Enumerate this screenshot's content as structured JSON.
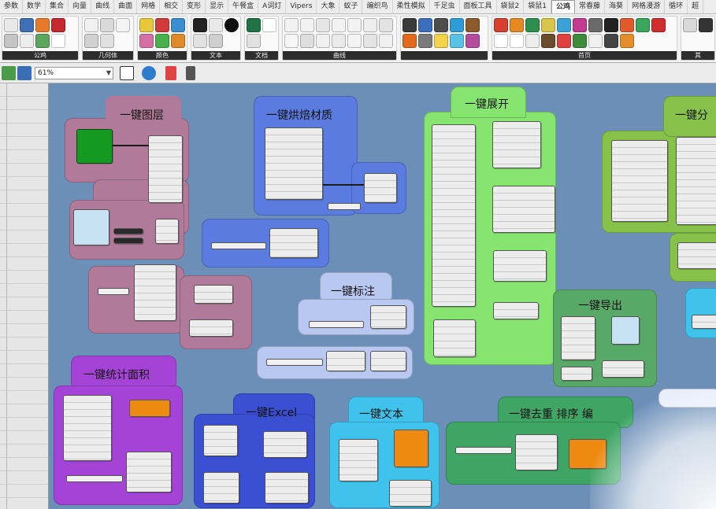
{
  "tabs": [
    "参数",
    "数学",
    "集合",
    "向量",
    "曲线",
    "曲面",
    "网格",
    "相交",
    "变形",
    "显示",
    "午餐盒",
    "A词灯",
    "Vipers",
    "大象",
    "蚁子",
    "编织鸟",
    "柔性模拟",
    "千足虫",
    "面板工具",
    "袋鼠2",
    "袋鼠1",
    "公鸡",
    "常春藤",
    "海葵",
    "网格漫游",
    "循环",
    "超"
  ],
  "active_tab": "公鸡",
  "ribbon_groups": [
    "公鸡",
    "几何体",
    "颜色",
    "文本",
    "文档",
    "曲线",
    "",
    "首页",
    "其"
  ],
  "toolbar": {
    "zoom": "61%"
  },
  "canvas_groups": [
    {
      "title": "一键图层"
    },
    {
      "title": "一键烘焙材质"
    },
    {
      "title": "一键展开"
    },
    {
      "title": "一键分"
    },
    {
      "title": "一键标注"
    },
    {
      "title": "一键导出"
    },
    {
      "title": "一键统计面积"
    },
    {
      "title": "一键Excel"
    },
    {
      "title": "一键文本"
    },
    {
      "title": "一键去重 排序 编"
    }
  ],
  "colors": {
    "canvas": "#6c8fb8",
    "layer_group": "#b07a98",
    "bake_group": "#5a7be0",
    "unfold_group": "#86e56e",
    "label_group": "#b9c8f0",
    "export_group": "#58a968",
    "area_group": "#a443d6",
    "excel_group": "#3a4fd2",
    "text_group": "#3fc3ec",
    "dedup_group": "#3fa565"
  }
}
